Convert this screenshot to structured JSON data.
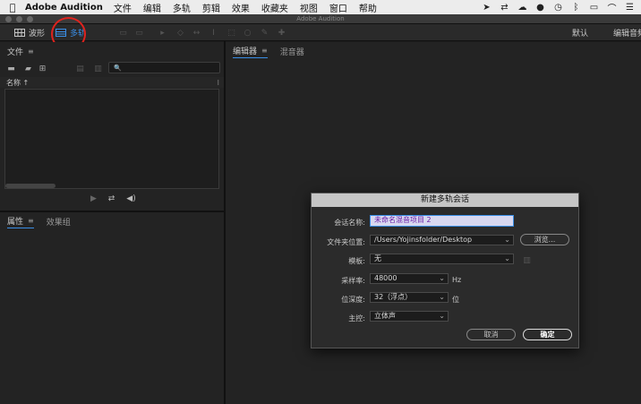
{
  "menubar": {
    "apple": "",
    "app_name": "Adobe Audition",
    "items": [
      "文件",
      "编辑",
      "多轨",
      "剪辑",
      "效果",
      "收藏夹",
      "视图",
      "窗口",
      "帮助"
    ]
  },
  "window": {
    "title": "Adobe Audition"
  },
  "toolbar": {
    "waveform_label": "波形",
    "multitrack_label": "多轨",
    "workspace_default": "默认",
    "workspace_edit_audio": "编辑音频"
  },
  "files_panel": {
    "title": "文件",
    "menu_icon": "≡",
    "search_icon": "🔍",
    "column_name": "名称 ↑"
  },
  "properties_panel": {
    "tab_properties": "属性",
    "tab_effects_rack": "效果组"
  },
  "editor_panel": {
    "tab_editor": "编辑器",
    "tab_mixer": "混音器"
  },
  "dialog": {
    "title": "新建多轨会话",
    "session_name_label": "会话名称:",
    "session_name_value": "未命名混音项目 2",
    "folder_label": "文件夹位置:",
    "folder_value": "/Users/Yojinsfolder/Desktop",
    "browse_label": "浏览...",
    "template_label": "模板:",
    "template_value": "无",
    "sample_rate_label": "采样率:",
    "sample_rate_value": "48000",
    "sample_rate_unit": "Hz",
    "bit_depth_label": "位深度:",
    "bit_depth_value": "32（浮点）",
    "bit_depth_unit": "位",
    "master_label": "主控:",
    "master_value": "立体声",
    "cancel_label": "取消",
    "ok_label": "确定"
  },
  "colors": {
    "accent": "#3a8ee6",
    "highlight_circle": "#e0231e"
  }
}
